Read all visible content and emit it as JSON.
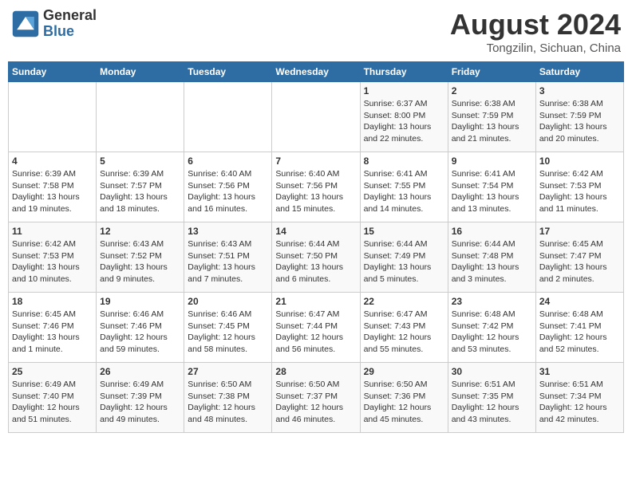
{
  "header": {
    "logo_general": "General",
    "logo_blue": "Blue",
    "title": "August 2024",
    "location": "Tongzilin, Sichuan, China"
  },
  "weekdays": [
    "Sunday",
    "Monday",
    "Tuesday",
    "Wednesday",
    "Thursday",
    "Friday",
    "Saturday"
  ],
  "weeks": [
    [
      {
        "day": "",
        "info": ""
      },
      {
        "day": "",
        "info": ""
      },
      {
        "day": "",
        "info": ""
      },
      {
        "day": "",
        "info": ""
      },
      {
        "day": "1",
        "info": "Sunrise: 6:37 AM\nSunset: 8:00 PM\nDaylight: 13 hours\nand 22 minutes."
      },
      {
        "day": "2",
        "info": "Sunrise: 6:38 AM\nSunset: 7:59 PM\nDaylight: 13 hours\nand 21 minutes."
      },
      {
        "day": "3",
        "info": "Sunrise: 6:38 AM\nSunset: 7:59 PM\nDaylight: 13 hours\nand 20 minutes."
      }
    ],
    [
      {
        "day": "4",
        "info": "Sunrise: 6:39 AM\nSunset: 7:58 PM\nDaylight: 13 hours\nand 19 minutes."
      },
      {
        "day": "5",
        "info": "Sunrise: 6:39 AM\nSunset: 7:57 PM\nDaylight: 13 hours\nand 18 minutes."
      },
      {
        "day": "6",
        "info": "Sunrise: 6:40 AM\nSunset: 7:56 PM\nDaylight: 13 hours\nand 16 minutes."
      },
      {
        "day": "7",
        "info": "Sunrise: 6:40 AM\nSunset: 7:56 PM\nDaylight: 13 hours\nand 15 minutes."
      },
      {
        "day": "8",
        "info": "Sunrise: 6:41 AM\nSunset: 7:55 PM\nDaylight: 13 hours\nand 14 minutes."
      },
      {
        "day": "9",
        "info": "Sunrise: 6:41 AM\nSunset: 7:54 PM\nDaylight: 13 hours\nand 13 minutes."
      },
      {
        "day": "10",
        "info": "Sunrise: 6:42 AM\nSunset: 7:53 PM\nDaylight: 13 hours\nand 11 minutes."
      }
    ],
    [
      {
        "day": "11",
        "info": "Sunrise: 6:42 AM\nSunset: 7:53 PM\nDaylight: 13 hours\nand 10 minutes."
      },
      {
        "day": "12",
        "info": "Sunrise: 6:43 AM\nSunset: 7:52 PM\nDaylight: 13 hours\nand 9 minutes."
      },
      {
        "day": "13",
        "info": "Sunrise: 6:43 AM\nSunset: 7:51 PM\nDaylight: 13 hours\nand 7 minutes."
      },
      {
        "day": "14",
        "info": "Sunrise: 6:44 AM\nSunset: 7:50 PM\nDaylight: 13 hours\nand 6 minutes."
      },
      {
        "day": "15",
        "info": "Sunrise: 6:44 AM\nSunset: 7:49 PM\nDaylight: 13 hours\nand 5 minutes."
      },
      {
        "day": "16",
        "info": "Sunrise: 6:44 AM\nSunset: 7:48 PM\nDaylight: 13 hours\nand 3 minutes."
      },
      {
        "day": "17",
        "info": "Sunrise: 6:45 AM\nSunset: 7:47 PM\nDaylight: 13 hours\nand 2 minutes."
      }
    ],
    [
      {
        "day": "18",
        "info": "Sunrise: 6:45 AM\nSunset: 7:46 PM\nDaylight: 13 hours\nand 1 minute."
      },
      {
        "day": "19",
        "info": "Sunrise: 6:46 AM\nSunset: 7:46 PM\nDaylight: 12 hours\nand 59 minutes."
      },
      {
        "day": "20",
        "info": "Sunrise: 6:46 AM\nSunset: 7:45 PM\nDaylight: 12 hours\nand 58 minutes."
      },
      {
        "day": "21",
        "info": "Sunrise: 6:47 AM\nSunset: 7:44 PM\nDaylight: 12 hours\nand 56 minutes."
      },
      {
        "day": "22",
        "info": "Sunrise: 6:47 AM\nSunset: 7:43 PM\nDaylight: 12 hours\nand 55 minutes."
      },
      {
        "day": "23",
        "info": "Sunrise: 6:48 AM\nSunset: 7:42 PM\nDaylight: 12 hours\nand 53 minutes."
      },
      {
        "day": "24",
        "info": "Sunrise: 6:48 AM\nSunset: 7:41 PM\nDaylight: 12 hours\nand 52 minutes."
      }
    ],
    [
      {
        "day": "25",
        "info": "Sunrise: 6:49 AM\nSunset: 7:40 PM\nDaylight: 12 hours\nand 51 minutes."
      },
      {
        "day": "26",
        "info": "Sunrise: 6:49 AM\nSunset: 7:39 PM\nDaylight: 12 hours\nand 49 minutes."
      },
      {
        "day": "27",
        "info": "Sunrise: 6:50 AM\nSunset: 7:38 PM\nDaylight: 12 hours\nand 48 minutes."
      },
      {
        "day": "28",
        "info": "Sunrise: 6:50 AM\nSunset: 7:37 PM\nDaylight: 12 hours\nand 46 minutes."
      },
      {
        "day": "29",
        "info": "Sunrise: 6:50 AM\nSunset: 7:36 PM\nDaylight: 12 hours\nand 45 minutes."
      },
      {
        "day": "30",
        "info": "Sunrise: 6:51 AM\nSunset: 7:35 PM\nDaylight: 12 hours\nand 43 minutes."
      },
      {
        "day": "31",
        "info": "Sunrise: 6:51 AM\nSunset: 7:34 PM\nDaylight: 12 hours\nand 42 minutes."
      }
    ]
  ]
}
